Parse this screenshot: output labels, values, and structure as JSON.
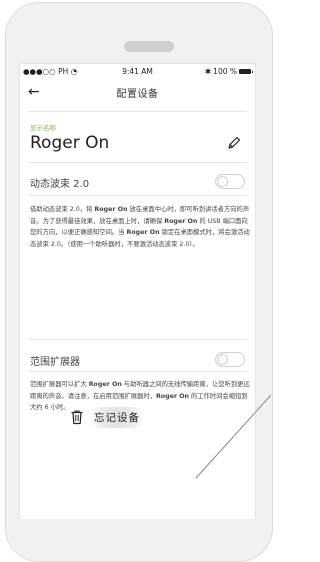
{
  "status_bar": {
    "carrier": "●●●○○ PH",
    "time": "9:41 AM",
    "battery": "100 %"
  },
  "nav": {
    "back_icon": "arrow-left-icon",
    "title": "配置设备"
  },
  "device": {
    "name_label": "显示名称",
    "name": "Roger On",
    "edit_icon": "pencil-icon"
  },
  "dynamic_fm": {
    "label": "动态波束 2.0",
    "enabled": false,
    "description_parts": [
      "借助动态波束 2.0，将 ",
      "Roger On",
      " 放在桌面中心时，即可听到讲话者方向的声音。为了获得最佳效果，放在桌面上时，请确保 ",
      "Roger On",
      " 的 USB 端口面向您的方向，以便正确感知空间。当 ",
      "Roger On",
      " 锁定在桌面模式时，将会激活动态波束 2.0。（使用一个助听器时，不要激活动态波束 2.0）。"
    ]
  },
  "range_extender": {
    "label": "范围扩展器",
    "enabled": false,
    "description_parts": [
      "范围扩展器可以扩大 ",
      "Roger On",
      " 与助听器之间的无线传输距离，让您听到更远距离的声音。请注意，在启用范围扩展器时，",
      "Roger On",
      " 的工作时间会缩短到大约 6 小时。"
    ]
  },
  "forget_device": {
    "label": "忘记设备",
    "icon": "trash-icon"
  },
  "colors": {
    "accent_green": "#7fb84a",
    "phone_frame": "#f1f1f1",
    "divider": "#e6e6e6"
  }
}
